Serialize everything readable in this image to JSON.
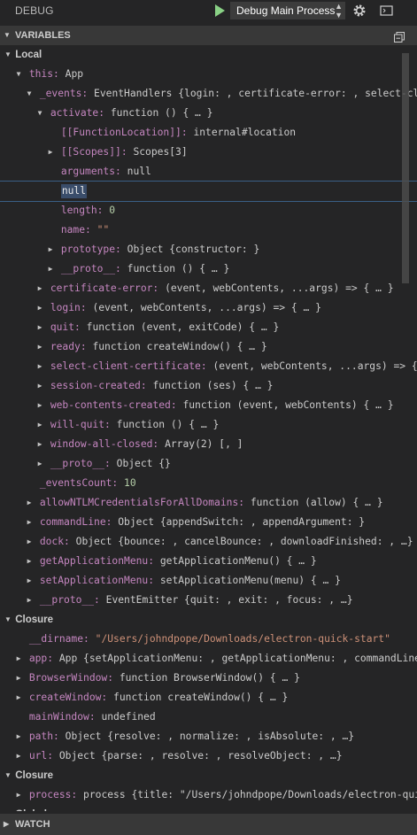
{
  "topbar": {
    "title": "DEBUG",
    "config": "Debug Main Process",
    "config_arrows": "▲▼"
  },
  "variables": {
    "title": "VARIABLES",
    "rows": [
      {
        "scope": true,
        "twisty": "▼",
        "text": "Local"
      },
      {
        "twisty": "▼",
        "key": "this:",
        "value": "App"
      },
      {
        "twisty": "▼",
        "key": "_events:",
        "value": "EventHandlers {login: , certificate-error: , select-cli…"
      },
      {
        "twisty": "▼",
        "key": "activate:",
        "value": "function () { … }"
      },
      {
        "twisty": "",
        "key": "[[FunctionLocation]]:",
        "value": "internal#location"
      },
      {
        "twisty": "▶",
        "key": "[[Scopes]]:",
        "value": "Scopes[3]"
      },
      {
        "twisty": "",
        "key": "arguments:",
        "value": "null"
      },
      {
        "twisty": "",
        "edit": "null"
      },
      {
        "twisty": "",
        "key": "length:",
        "value": "0",
        "vclass": "n"
      },
      {
        "twisty": "",
        "key": "name:",
        "value": "\"\"",
        "vclass": "s"
      },
      {
        "twisty": "▶",
        "key": "prototype:",
        "value": "Object {constructor: }"
      },
      {
        "twisty": "▶",
        "key": "__proto__:",
        "value": "function () { … }"
      },
      {
        "twisty": "▶",
        "key": "certificate-error:",
        "value": "(event, webContents, ...args) => { … }"
      },
      {
        "twisty": "▶",
        "key": "login:",
        "value": "(event, webContents, ...args) => { … }"
      },
      {
        "twisty": "▶",
        "key": "quit:",
        "value": "function (event, exitCode) { … }"
      },
      {
        "twisty": "▶",
        "key": "ready:",
        "value": "function createWindow() { … }"
      },
      {
        "twisty": "▶",
        "key": "select-client-certificate:",
        "value": "(event, webContents, ...args) => {…"
      },
      {
        "twisty": "▶",
        "key": "session-created:",
        "value": "function (ses) { … }"
      },
      {
        "twisty": "▶",
        "key": "web-contents-created:",
        "value": "function (event, webContents) { … }"
      },
      {
        "twisty": "▶",
        "key": "will-quit:",
        "value": "function () { … }"
      },
      {
        "twisty": "▶",
        "key": "window-all-closed:",
        "value": "Array(2) [, ]"
      },
      {
        "twisty": "▶",
        "key": "__proto__:",
        "value": "Object {}"
      },
      {
        "twisty": "",
        "key": "_eventsCount:",
        "value": "10",
        "vclass": "n"
      },
      {
        "twisty": "▶",
        "key": "allowNTLMCredentialsForAllDomains:",
        "value": "function (allow) { … }"
      },
      {
        "twisty": "▶",
        "key": "commandLine:",
        "value": "Object {appendSwitch: , appendArgument: }"
      },
      {
        "twisty": "▶",
        "key": "dock:",
        "value": "Object {bounce: , cancelBounce: , downloadFinished: , …}"
      },
      {
        "twisty": "▶",
        "key": "getApplicationMenu:",
        "value": "getApplicationMenu() { … }"
      },
      {
        "twisty": "▶",
        "key": "setApplicationMenu:",
        "value": "setApplicationMenu(menu) { … }"
      },
      {
        "twisty": "▶",
        "key": "__proto__:",
        "value": "EventEmitter {quit: , exit: , focus: , …}"
      },
      {
        "scope": true,
        "twisty": "▼",
        "text": "Closure"
      },
      {
        "twisty": "",
        "key": "__dirname:",
        "value": "\"/Users/johndpope/Downloads/electron-quick-start\"",
        "vclass": "s"
      },
      {
        "twisty": "▶",
        "key": "app:",
        "value": "App {setApplicationMenu: , getApplicationMenu: , commandLine…"
      },
      {
        "twisty": "▶",
        "key": "BrowserWindow:",
        "value": "function BrowserWindow() { … }"
      },
      {
        "twisty": "▶",
        "key": "createWindow:",
        "value": "function createWindow() { … }"
      },
      {
        "twisty": "",
        "key": "mainWindow:",
        "value": "undefined"
      },
      {
        "twisty": "▶",
        "key": "path:",
        "value": "Object {resolve: , normalize: , isAbsolute: , …}"
      },
      {
        "twisty": "▶",
        "key": "url:",
        "value": "Object {parse: , resolve: , resolveObject: , …}"
      },
      {
        "scope": true,
        "twisty": "▼",
        "text": "Closure"
      },
      {
        "twisty": "▶",
        "key": "process:",
        "value": "process {title: \"/Users/johndpope/Downloads/electron-qui…"
      },
      {
        "scope": true,
        "twisty": "▶",
        "text": "Global"
      }
    ]
  },
  "watch": {
    "title": "WATCH"
  }
}
